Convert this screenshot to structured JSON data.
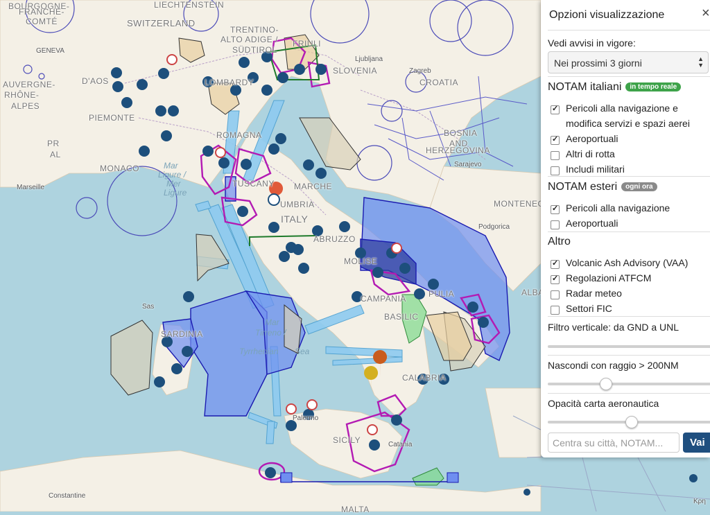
{
  "panel": {
    "title": "Opzioni visualizzazione",
    "close_label": "×",
    "notices_label": "Vedi avvisi in vigore:",
    "notices_select": "Nei prossimi 3 giorni",
    "italian_header": "NOTAM italiani",
    "italian_badge": "in tempo reale",
    "italian_items": [
      {
        "line1": "Pericoli alla navigazione e",
        "line2": "modifica servizi e spazi aerei",
        "checked": true
      },
      {
        "line1": "Aeroportuali",
        "checked": true
      },
      {
        "line1": "Altri di rotta",
        "checked": false
      },
      {
        "line1": "Includi militari",
        "checked": false
      }
    ],
    "foreign_header": "NOTAM esteri",
    "foreign_badge": "ogni ora",
    "foreign_items": [
      {
        "line1": "Pericoli alla navigazione",
        "checked": true
      },
      {
        "line1": "Aeroportuali",
        "checked": false
      }
    ],
    "other_header": "Altro",
    "other_items": [
      {
        "line1": "Volcanic Ash Advisory (VAA)",
        "checked": true
      },
      {
        "line1": "Regolazioni ATFCM",
        "checked": true
      },
      {
        "line1": "Radar meteo",
        "checked": false
      },
      {
        "line1": "Settori FIC",
        "checked": false
      }
    ],
    "vertical_filter_label": "Filtro verticale: da GND a UNL",
    "vertical_filter_level": 1.0,
    "radius_label": "Nascondi con raggio > 200NM",
    "radius_level": 0.33,
    "opacity_label": "Opacità carta aeronautica",
    "opacity_level": 0.48,
    "search_placeholder": "Centra su città, NOTAM...",
    "go_label": "Vai"
  },
  "map_labels": {
    "bourgogne": "BOURGOGNE-",
    "franche_comte": "FRANCHE-",
    "comte": "COMTÉ",
    "liechtenstein": "LIECHTENSTEIN",
    "switzerland": "SWITZERLAND",
    "geneva": "GENEVA",
    "trentino": "TRENTINO-",
    "alto_adige": "ALTO ADIGE /",
    "sudtirol": "SÜDTIROL",
    "friuli": "FRIULI",
    "ljubljana": "Ljubljana",
    "zagreb": "Zagreb",
    "slovenia": "SLOVENIA",
    "croatia": "CROATIA",
    "auvergne": "AUVERGNE-",
    "rhone": "RHÔNE-",
    "alpes": "ALPES",
    "aosta": "D'AOS",
    "piemonte": "PIEMONTE",
    "lombardy": "LOMBARDY",
    "romagna": "ROMAGNA",
    "pr": "PR",
    "al": "AL",
    "monaco": "MONACO",
    "marseille": "Marseille",
    "mar_ligure_1": "Mar",
    "mar_ligure_2": "Ligure /",
    "mar_ligure_3": "Mer",
    "mar_ligure_4": "Ligure",
    "tuscany": "TUSCANY",
    "umbria": "UMBRIA",
    "marche": "MARCHE",
    "italy": "ITALY",
    "bosnia": "BOSNIA",
    "and": "AND",
    "herzegovina": "HERZEGOVINA",
    "sarajevo": "Sarajevo",
    "montenegro": "MONTENEGRO",
    "podgorica": "Podgorica",
    "abruzzo": "ABRUZZO",
    "molise": "MOLISE",
    "campania": "CAMPANIA",
    "apulia": "PULIA",
    "basilicata": "BASILIC",
    "sardinia": "SARDINIA",
    "sassari": "Sas",
    "mar_tirreno_1": "Mar",
    "mar_tirreno_2": "Tirreno /",
    "mar_tirreno_3": "Tyrrhenian",
    "mar_tirreno_4": "Sea",
    "calabria": "CALABRIA",
    "sicily": "SICILY",
    "palermo": "Palermo",
    "catania": "Catania",
    "constantine": "Constantine",
    "alba": "ALBA",
    "kriti": "Κρη",
    "malta": "MALTA"
  },
  "colors": {
    "sea": "#aed3df",
    "land": "#f3efe4",
    "restricted_fill": "#6f8ef0",
    "purple": "#b31ab3",
    "route": "#7cc4ee",
    "airport": "#1d4f7c",
    "badge_green": "#3ea34a",
    "badge_grey": "#8a8a8a",
    "go_button": "#1f4f7f"
  }
}
